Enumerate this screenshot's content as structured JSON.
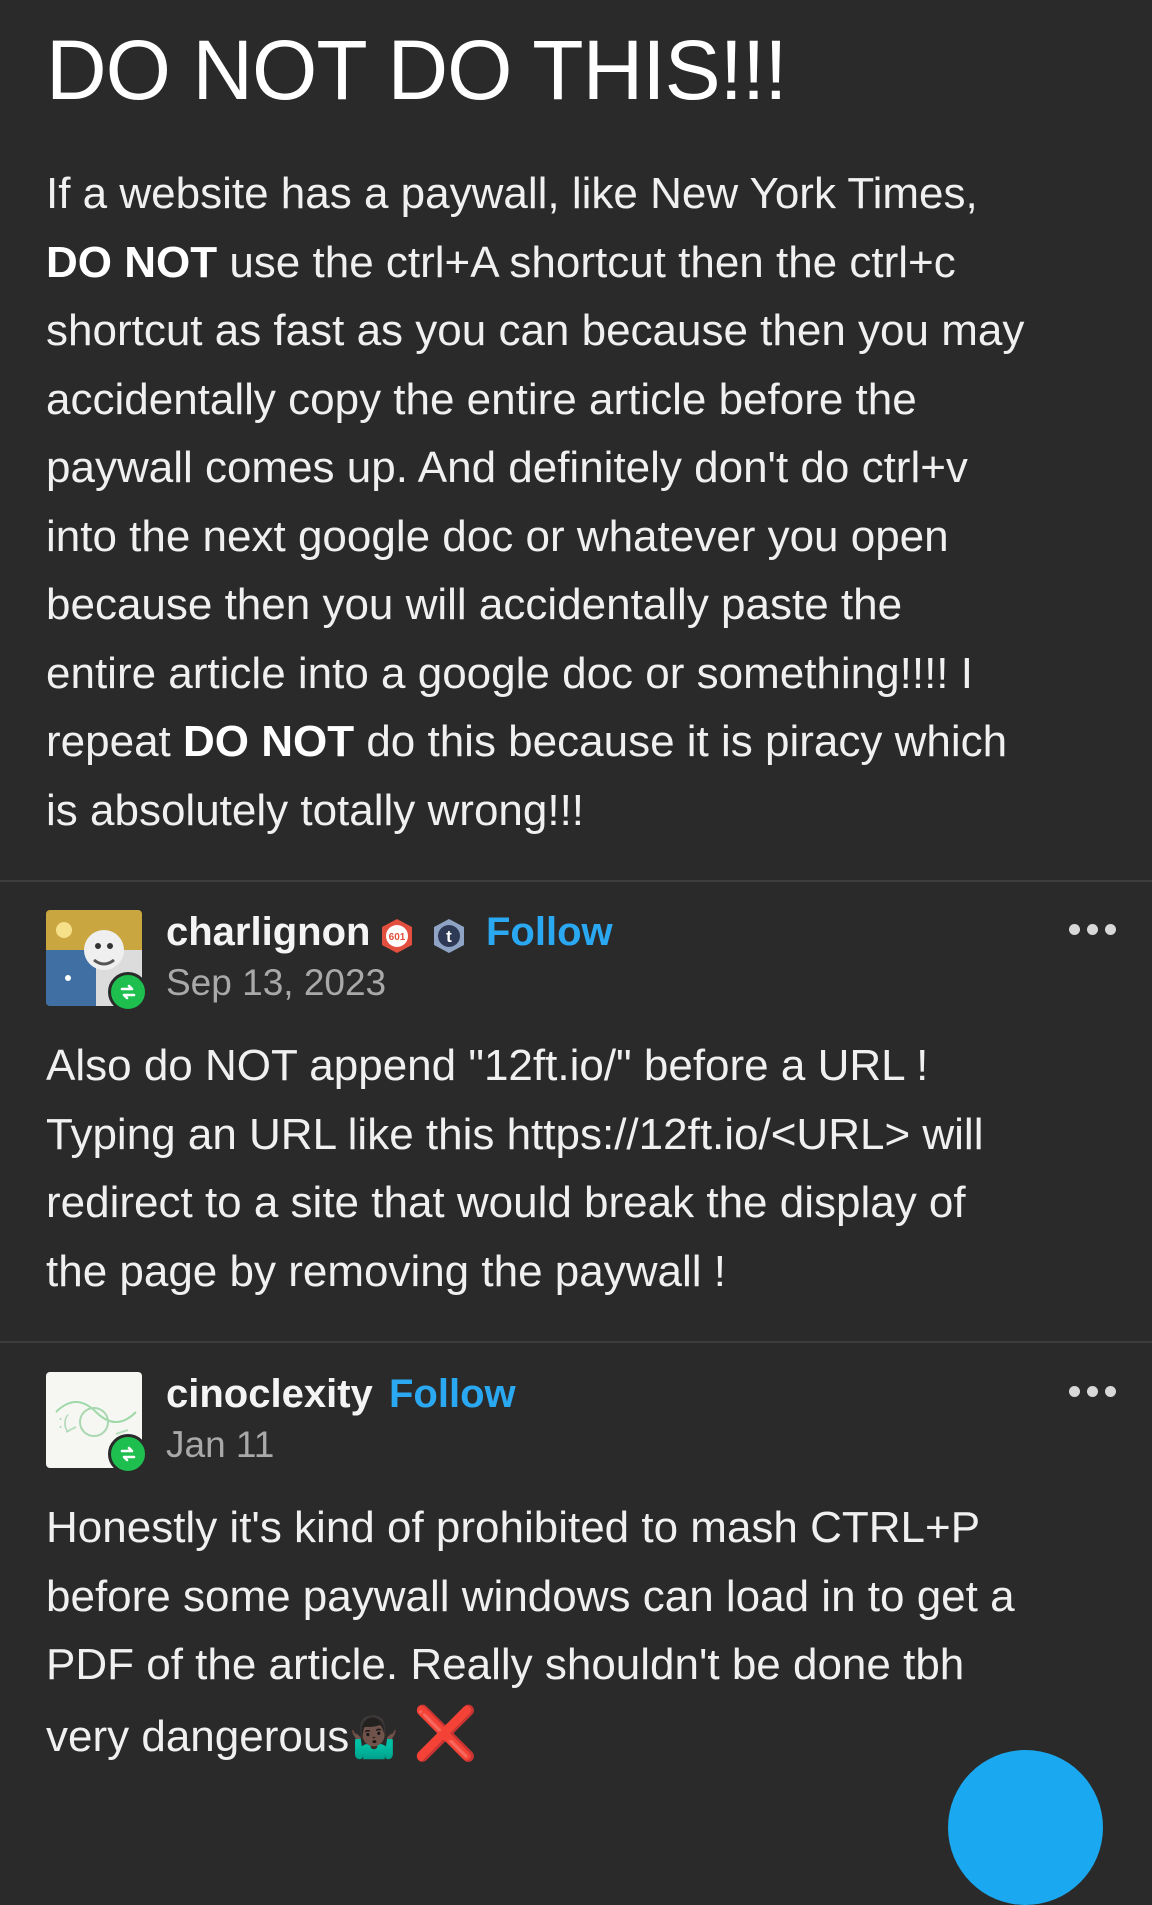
{
  "post": {
    "title": "DO NOT DO THIS!!!",
    "lines": [
      {
        "pre": "If a website has a paywall, like New York Times,",
        "bold": "",
        "post": ""
      },
      {
        "pre": "",
        "bold": "DO NOT",
        "post": " use the ctrl+A shortcut then the ctrl+c"
      },
      {
        "pre": "shortcut as fast as you can because then you may",
        "bold": "",
        "post": ""
      },
      {
        "pre": "accidentally copy the entire article before the",
        "bold": "",
        "post": ""
      },
      {
        "pre": "paywall comes up. And definitely don't do ctrl+v",
        "bold": "",
        "post": ""
      },
      {
        "pre": "into the next google doc or whatever you open",
        "bold": "",
        "post": ""
      },
      {
        "pre": "because then you will accidentally paste the",
        "bold": "",
        "post": ""
      },
      {
        "pre": "entire article into a google doc or something!!!! I",
        "bold": "",
        "post": ""
      },
      {
        "pre": "repeat ",
        "bold": "DO NOT",
        "post": " do this because it is piracy which"
      },
      {
        "pre": "is absolutely totally wrong!!!",
        "bold": "",
        "post": ""
      }
    ]
  },
  "reblog1": {
    "username": "charlignon",
    "badge_text": "601",
    "follow_label": "Follow",
    "date": "Sep 13, 2023",
    "lines": [
      "Also do NOT append \"12ft.io/\" before a URL !",
      "Typing an URL like this https://12ft.io/<URL> will",
      "redirect to a site that would break the display of",
      "the page by removing the paywall !"
    ]
  },
  "reblog2": {
    "username": "cinoclexity",
    "follow_label": "Follow",
    "date": "Jan 11",
    "lines": [
      "Honestly it's kind of prohibited to mash CTRL+P",
      "before some paywall windows can load in to get a",
      "PDF of the article.  Really shouldn't be done tbh",
      "very dangerous"
    ],
    "emoji_1": "🤷🏿‍♂️",
    "emoji_2": "❌"
  },
  "colors": {
    "background": "#2a2a2a",
    "follow": "#2aa9f2",
    "reblog_badge": "#1fbf4f",
    "fab": "#1aa9f0"
  },
  "icons": [
    "reblog-icon",
    "more-options-icon",
    "tumblr-badge-icon",
    "community-badge-icon"
  ]
}
